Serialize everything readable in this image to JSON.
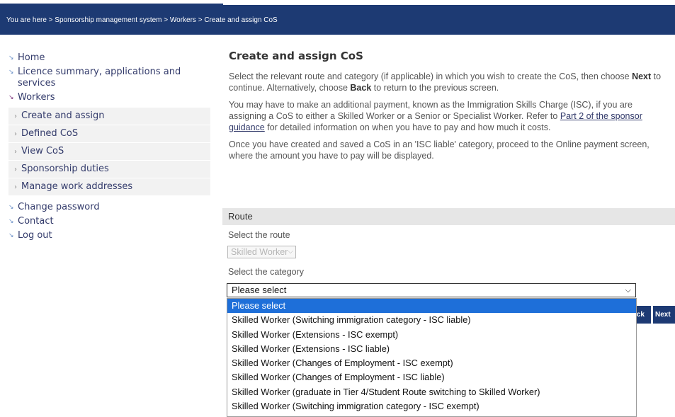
{
  "breadcrumb": {
    "prefix": "You are here >",
    "items": [
      "Sponsorship management system",
      "Workers",
      "Create and assign CoS"
    ],
    "text": "You are here > Sponsorship management system > Workers > Create and assign CoS"
  },
  "sidebar": {
    "items": [
      {
        "label": "Home"
      },
      {
        "label": "Licence summary, applications and services"
      },
      {
        "label": "Workers"
      }
    ],
    "workers_subitems": [
      {
        "label": "Create and assign"
      },
      {
        "label": "Defined CoS"
      },
      {
        "label": "View CoS"
      },
      {
        "label": "Sponsorship duties"
      },
      {
        "label": "Manage work addresses"
      }
    ],
    "bottom_items": [
      {
        "label": "Change password"
      },
      {
        "label": "Contact"
      },
      {
        "label": "Log out"
      }
    ]
  },
  "main": {
    "title": "Create and assign CoS",
    "para1_a": "Select the relevant route and category (if applicable) in which you wish to create the CoS, then choose ",
    "para1_next": "Next",
    "para1_b": " to continue. Alternatively, choose ",
    "para1_back": "Back",
    "para1_c": " to return to the previous screen.",
    "para2_a": "You may have to make an additional payment, known as the Immigration Skills Charge (ISC), if you are assigning a CoS to either a Skilled Worker or a Senior or Specialist Worker. Refer to ",
    "para2_link": "Part 2 of the sponsor guidance",
    "para2_b": " for detailed information on when you have to pay and how much it costs.",
    "para3": "Once you have created and saved a CoS in an 'ISC liable' category, proceed to the Online payment screen, where the amount you have to pay will be displayed."
  },
  "route": {
    "section_title": "Route",
    "route_label": "Select the route",
    "route_value": "Skilled Worker",
    "category_label": "Select the category",
    "category_value": "Please select",
    "category_options": [
      "Please select",
      "Skilled Worker (Switching immigration category - ISC liable)",
      "Skilled Worker (Extensions - ISC exempt)",
      "Skilled Worker (Extensions - ISC liable)",
      "Skilled Worker (Changes of Employment - ISC exempt)",
      "Skilled Worker (Changes of Employment - ISC liable)",
      "Skilled Worker (graduate in Tier 4/Student Route switching to Skilled Worker)",
      "Skilled Worker (Switching immigration category - ISC exempt)"
    ],
    "selected_index": 0
  },
  "buttons": {
    "back_label": "Back",
    "next_label": "Next"
  },
  "colors": {
    "header_bg": "#1d3a73",
    "selected_option_bg": "#1e6fd9",
    "route_bar_bg": "#e6e6e6"
  }
}
